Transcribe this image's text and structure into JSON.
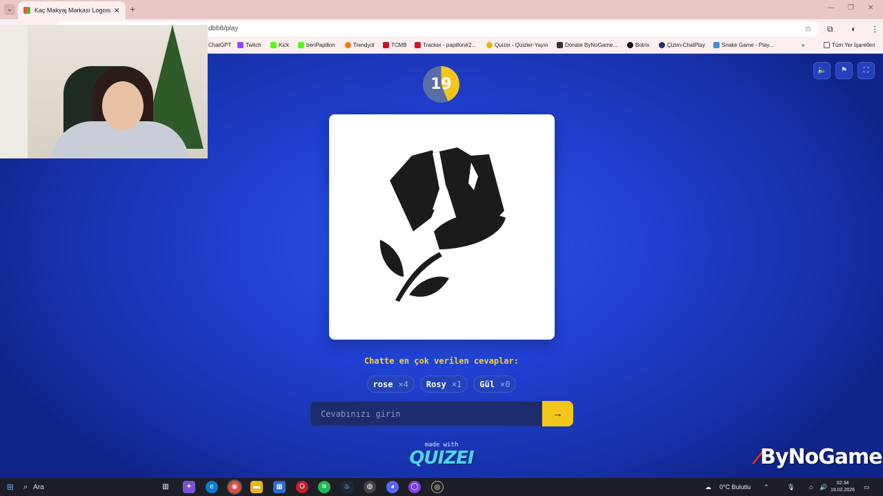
{
  "browser": {
    "tab_title": "Kaç Makyaj Markası Logosu Bil",
    "address": "dbb8/play",
    "bookmarks": [
      "ChatGPT",
      "Twitch",
      "Kick",
      "benPapillon",
      "Trendyol",
      "TCMB",
      "Tracker - papillon#2...",
      "Quizei - Quizler-Yayın",
      "Donate ByNoGame...",
      "Botrix",
      "Çizim-ChatPlay",
      "Snake Game - Play..."
    ],
    "bookmarks_folder": "Tüm Yer İşaretleri"
  },
  "game": {
    "timer": "19",
    "timer_fraction": 0.44,
    "image_icon": "rose-icon",
    "chat_title": "Chatte en çok verilen cevaplar:",
    "answers": [
      {
        "text": "rose",
        "count": "×4"
      },
      {
        "text": "Rosy",
        "count": "×1"
      },
      {
        "text": "Gül",
        "count": "×0"
      }
    ],
    "input_placeholder": "Cevabınızı girin",
    "submit_label": "→",
    "made_with": "made with",
    "logo": "QUIZEI"
  },
  "overlay": {
    "brand": "ByNoGame"
  },
  "taskbar": {
    "search_label": "Ara",
    "weather": "0°C  Bulutlu",
    "time": "02:34",
    "date": "19.02.2026"
  },
  "colors": {
    "accent": "#f3c61c",
    "background": "#1f3fcf",
    "chip": "#2543b8"
  }
}
